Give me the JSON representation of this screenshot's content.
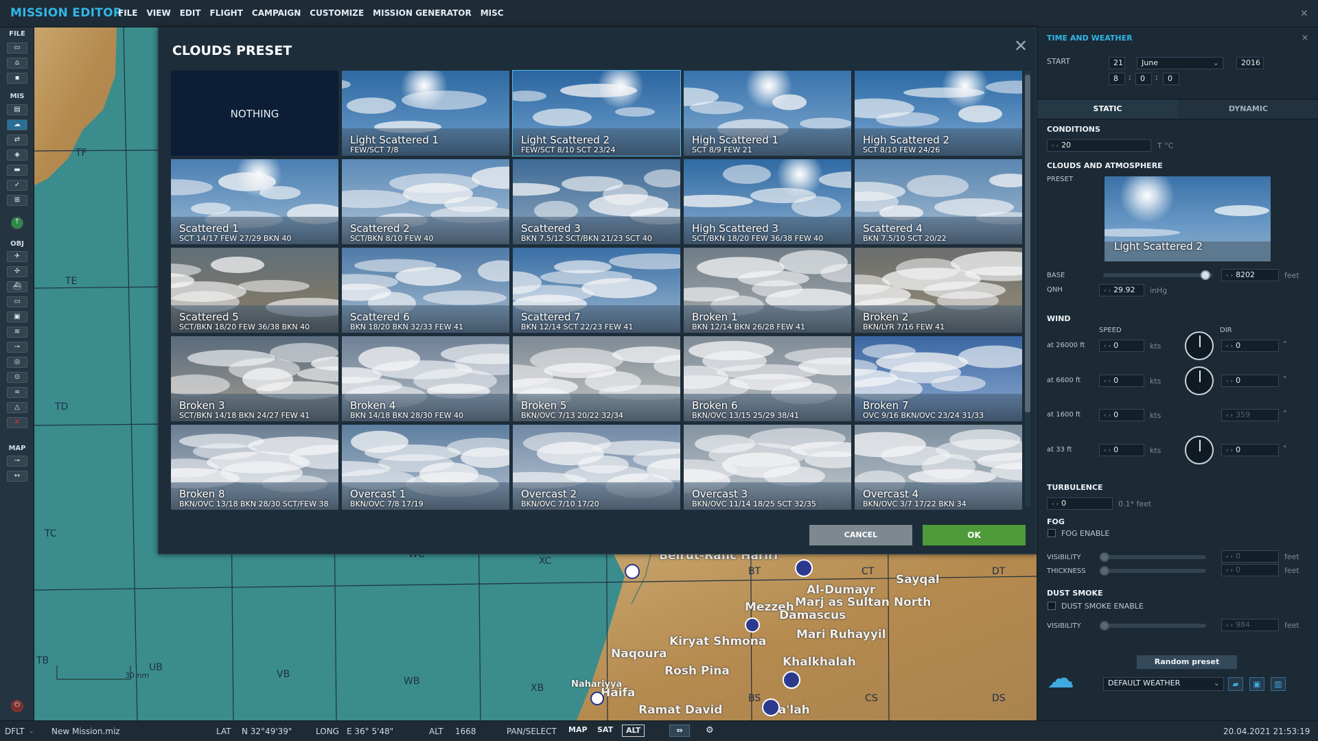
{
  "app": {
    "title": "MISSION EDITOR"
  },
  "menu": [
    "FILE",
    "VIEW",
    "EDIT",
    "FLIGHT",
    "CAMPAIGN",
    "CUSTOMIZE",
    "MISSION GENERATOR",
    "MISC"
  ],
  "sidebar": {
    "headers": {
      "file": "FILE",
      "mis": "MIS",
      "obj": "OBJ",
      "map": "MAP"
    }
  },
  "map": {
    "grid_labels": [
      "TF",
      "TE",
      "TD",
      "TC",
      "TB",
      "UB",
      "VB",
      "WB",
      "XB",
      "WC",
      "XC",
      "BT",
      "CT",
      "DT",
      "BS",
      "CS",
      "DS"
    ],
    "cities": [
      "Beirut-Rafic Hariri",
      "Al-Dumayr",
      "Sayqal",
      "Mezzeh",
      "Marj as Sultan North",
      "Damascus",
      "Mari Ruhayyil",
      "Kiryat Shmona",
      "Naqoura",
      "Rosh Pina",
      "Khalkhalah",
      "Haifa",
      "Ramat David",
      "Tha'lah",
      "Nahariyya"
    ],
    "scale_label": "30 nm"
  },
  "dialog": {
    "title": "CLOUDS PRESET",
    "cancel_label": "CANCEL",
    "ok_label": "OK",
    "nothing_label": "NOTHING",
    "presets": [
      {
        "name": "Light Scattered 1",
        "code": "FEW/SCT 7/8"
      },
      {
        "name": "Light Scattered 2",
        "code": "FEW/SCT 8/10 SCT 23/24",
        "selected": true
      },
      {
        "name": "High Scattered 1",
        "code": "SCT 8/9 FEW 21"
      },
      {
        "name": "High Scattered 2",
        "code": "SCT 8/10 FEW 24/26"
      },
      {
        "name": "Scattered 1",
        "code": "SCT 14/17 FEW 27/29 BKN 40"
      },
      {
        "name": "Scattered 2",
        "code": "SCT/BKN 8/10 FEW 40"
      },
      {
        "name": "Scattered 3",
        "code": "BKN 7.5/12 SCT/BKN 21/23 SCT 40"
      },
      {
        "name": "High Scattered 3",
        "code": "SCT/BKN  18/20 FEW 36/38 FEW 40"
      },
      {
        "name": "Scattered 4",
        "code": "BKN 7.5/10 SCT 20/22"
      },
      {
        "name": "Scattered 5",
        "code": "SCT/BKN 18/20 FEW 36/38 BKN 40"
      },
      {
        "name": "Scattered 6",
        "code": "BKN 18/20 BKN 32/33 FEW 41"
      },
      {
        "name": "Scattered 7",
        "code": "BKN 12/14 SCT 22/23 FEW 41"
      },
      {
        "name": "Broken 1",
        "code": "BKN 12/14 BKN 26/28 FEW 41"
      },
      {
        "name": "Broken 2",
        "code": "BKN/LYR 7/16 FEW 41"
      },
      {
        "name": "Broken 3",
        "code": "SCT/BKN 14/18 BKN 24/27 FEW 41"
      },
      {
        "name": "Broken 4",
        "code": "BKN 14/18 BKN 28/30 FEW 40"
      },
      {
        "name": "Broken 5",
        "code": "BKN/OVC 7/13 20/22 32/34"
      },
      {
        "name": "Broken 6",
        "code": "BKN/OVC 13/15 25/29 38/41"
      },
      {
        "name": "Broken 7",
        "code": "OVC 9/16 BKN/OVC 23/24 31/33"
      },
      {
        "name": "Broken 8",
        "code": "BKN/OVC 13/18 BKN 28/30 SCT/FEW 38"
      },
      {
        "name": "Overcast 1",
        "code": "BKN/OVC 7/8 17/19"
      },
      {
        "name": "Overcast 2",
        "code": "BKN/OVC 7/10 17/20"
      },
      {
        "name": "Overcast 3",
        "code": "BKN/OVC 11/14 18/25 SCT 32/35"
      },
      {
        "name": "Overcast 4",
        "code": "BKN/OVC 3/7 17/22 BKN 34"
      }
    ]
  },
  "weather": {
    "title": "TIME AND WEATHER",
    "start_label": "START",
    "day": "21",
    "month": "June",
    "year": "2016",
    "hour": "8",
    "minute": "0",
    "second": "0",
    "tab_static": "STATIC",
    "tab_dynamic": "DYNAMIC",
    "conditions_label": "CONDITIONS",
    "temperature": "20",
    "temp_unit": "T °C",
    "clouds_label": "CLOUDS AND ATMOSPHERE",
    "preset_label": "PRESET",
    "preset_name": "Light Scattered 2",
    "base_label": "BASE",
    "base_value": "8202",
    "base_unit": "feet",
    "qnh_label": "QNH",
    "qnh_value": "29.92",
    "qnh_unit": "inHg",
    "wind_label": "WIND",
    "speed_label": "SPEED",
    "dir_label": "DIR",
    "wind_rows": [
      {
        "alt": "at 26000 ft",
        "speed": "0",
        "dir": "0",
        "dir_disabled": false
      },
      {
        "alt": "at 6600 ft",
        "speed": "0",
        "dir": "0",
        "dir_disabled": false
      },
      {
        "alt": "at 1600 ft",
        "speed": "0",
        "dir": "359",
        "dir_disabled": true
      },
      {
        "alt": "at 33 ft",
        "speed": "0",
        "dir": "0",
        "dir_disabled": false
      }
    ],
    "kts_unit": "kts",
    "deg_unit": "°",
    "turbulence_label": "TURBULENCE",
    "turbulence_value": "0",
    "turbulence_unit": "0.1* feet",
    "fog_label": "FOG",
    "fog_enable": "FOG ENABLE",
    "visibility_label": "VISIBILITY",
    "thickness_label": "THICKNESS",
    "fog_visibility": "0",
    "fog_thickness": "0",
    "feet_unit": "feet",
    "dust_label": "DUST SMOKE",
    "dust_enable": "DUST SMOKE ENABLE",
    "dust_visibility": "984",
    "random_preset": "Random preset",
    "weather_preset_select": "DEFAULT WEATHER"
  },
  "status": {
    "profile": "DFLT",
    "file": "New Mission.miz",
    "lat_label": "LAT",
    "lat": "N 32°49'39\"",
    "long_label": "LONG",
    "long": "E 36° 5'48\"",
    "alt_label": "ALT",
    "alt": "1668",
    "mode": "PAN/SELECT",
    "map_btn": "MAP",
    "sat_btn": "SAT",
    "alt_btn": "ALT",
    "datetime": "20.04.2021 21:53:19"
  },
  "colors": {
    "accent": "#33b6e6",
    "ok": "#4f9b3a",
    "cancel": "#7d8890"
  }
}
